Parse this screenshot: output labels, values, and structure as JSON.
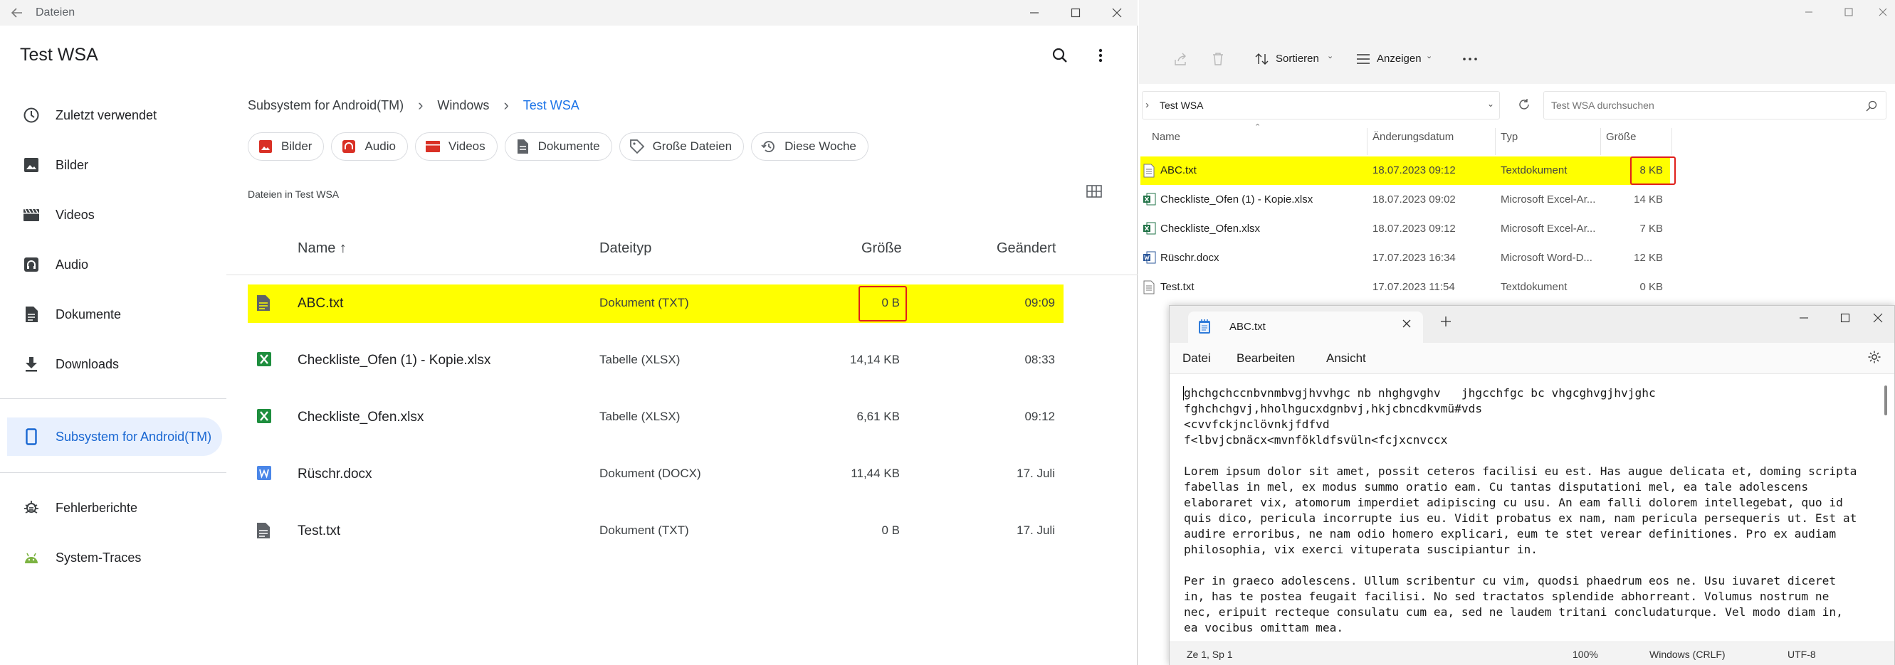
{
  "android": {
    "window_title": "Dateien",
    "app_title": "Test WSA",
    "nav": [
      {
        "label": "Zuletzt verwendet",
        "icon": "clock-icon"
      },
      {
        "label": "Bilder",
        "icon": "image-icon"
      },
      {
        "label": "Videos",
        "icon": "video-icon"
      },
      {
        "label": "Audio",
        "icon": "audio-icon"
      },
      {
        "label": "Dokumente",
        "icon": "document-icon"
      },
      {
        "label": "Downloads",
        "icon": "download-icon"
      },
      {
        "label": "Subsystem for Android(TM)",
        "icon": "phone-icon",
        "active": true
      },
      {
        "label": "Fehlerberichte",
        "icon": "bug-icon"
      },
      {
        "label": "System-Traces",
        "icon": "android-icon"
      }
    ],
    "breadcrumb": [
      "Subsystem for Android(TM)",
      "Windows",
      "Test WSA"
    ],
    "chips": [
      "Bilder",
      "Audio",
      "Videos",
      "Dokumente",
      "Große Dateien",
      "Diese Woche"
    ],
    "section_label": "Dateien in Test WSA",
    "columns": {
      "name": "Name",
      "type": "Dateityp",
      "size": "Größe",
      "modified": "Geändert"
    },
    "files": [
      {
        "name": "ABC.txt",
        "type": "Dokument (TXT)",
        "size": "0 B",
        "modified": "09:09",
        "icon": "text-file-icon",
        "selected": true
      },
      {
        "name": "Checkliste_Ofen (1) - Kopie.xlsx",
        "type": "Tabelle (XLSX)",
        "size": "14,14 KB",
        "modified": "08:33",
        "icon": "excel-icon"
      },
      {
        "name": "Checkliste_Ofen.xlsx",
        "type": "Tabelle (XLSX)",
        "size": "6,61 KB",
        "modified": "09:12",
        "icon": "excel-icon"
      },
      {
        "name": "Rüschr.docx",
        "type": "Dokument (DOCX)",
        "size": "11,44 KB",
        "modified": "17. Juli",
        "icon": "word-icon"
      },
      {
        "name": "Test.txt",
        "type": "Dokument (TXT)",
        "size": "0 B",
        "modified": "17. Juli",
        "icon": "text-file-icon"
      }
    ]
  },
  "explorer": {
    "toolbar": {
      "sort": "Sortieren",
      "view": "Anzeigen"
    },
    "address": "Test WSA",
    "search_placeholder": "Test WSA durchsuchen",
    "columns": {
      "name": "Name",
      "date": "Änderungsdatum",
      "type": "Typ",
      "size": "Größe"
    },
    "files": [
      {
        "name": "ABC.txt",
        "date": "18.07.2023 09:12",
        "type": "Textdokument",
        "size": "8 KB",
        "selected": true
      },
      {
        "name": "Checkliste_Ofen (1) - Kopie.xlsx",
        "date": "18.07.2023 09:02",
        "type": "Microsoft Excel-Ar...",
        "size": "14 KB"
      },
      {
        "name": "Checkliste_Ofen.xlsx",
        "date": "18.07.2023 09:12",
        "type": "Microsoft Excel-Ar...",
        "size": "7 KB"
      },
      {
        "name": "Rüschr.docx",
        "date": "17.07.2023 16:34",
        "type": "Microsoft Word-D...",
        "size": "12 KB"
      },
      {
        "name": "Test.txt",
        "date": "17.07.2023 11:54",
        "type": "Textdokument",
        "size": "0 KB"
      }
    ]
  },
  "notepad": {
    "tab_title": "ABC.txt",
    "menu": [
      "Datei",
      "Bearbeiten",
      "Ansicht"
    ],
    "content": "ghchgchccnbvnmbvgjhvvhgc nb nhghgvghv   jhgcchfgc bc vhgcghvgjhvjghc\nfghchchgvj,hholhgucxdgnbvj,hkjcbncdkvmü#vds\n<cvvfckjnclövnkjfdfvd\nf<lbvjcbnäcx<mvnfökldfsvüln<fcjxcnvccx\n\nLorem ipsum dolor sit amet, possit ceteros facilisi eu est. Has augue delicata et, doming scripta\nfabellas in mel, ex modus summo oratio eam. Cu tantas disputationi mel, ea tale adolescens\nelaboraret vix, atomorum imperdiet adipiscing cu usu. An eam falli dolorem intellegebat, quo id\nquis dico, pericula incorrupte ius eu. Vidit probatus ex nam, nam pericula persequeris ut. Est at\naudire erroribus, ne nam odio homero explicari, eum te stet verear definitiones. Pro ex audiam\nphilosophia, vix exerci vituperata suscipiantur in.\n\nPer in graeco adolescens. Ullum scribentur cu vim, quodsi phaedrum eos ne. Usu iuvaret diceret\nin, has te postea feugait facilisi. No sed tractatos splendide abhorreant. Volumus nostrum ne\nnec, eripuit recteque consulatu cum ea, sed ne laudem tritani concludaturque. Vel modo diam in,\nea vocibus omittam mea.",
    "status": {
      "position": "Ze 1, Sp 1",
      "zoom": "100%",
      "line_ending": "Windows (CRLF)",
      "encoding": "UTF-8"
    }
  },
  "colors": {
    "highlight": "#ffff00",
    "annotation_box": "#e0201c",
    "accent": "#1a73e8"
  }
}
